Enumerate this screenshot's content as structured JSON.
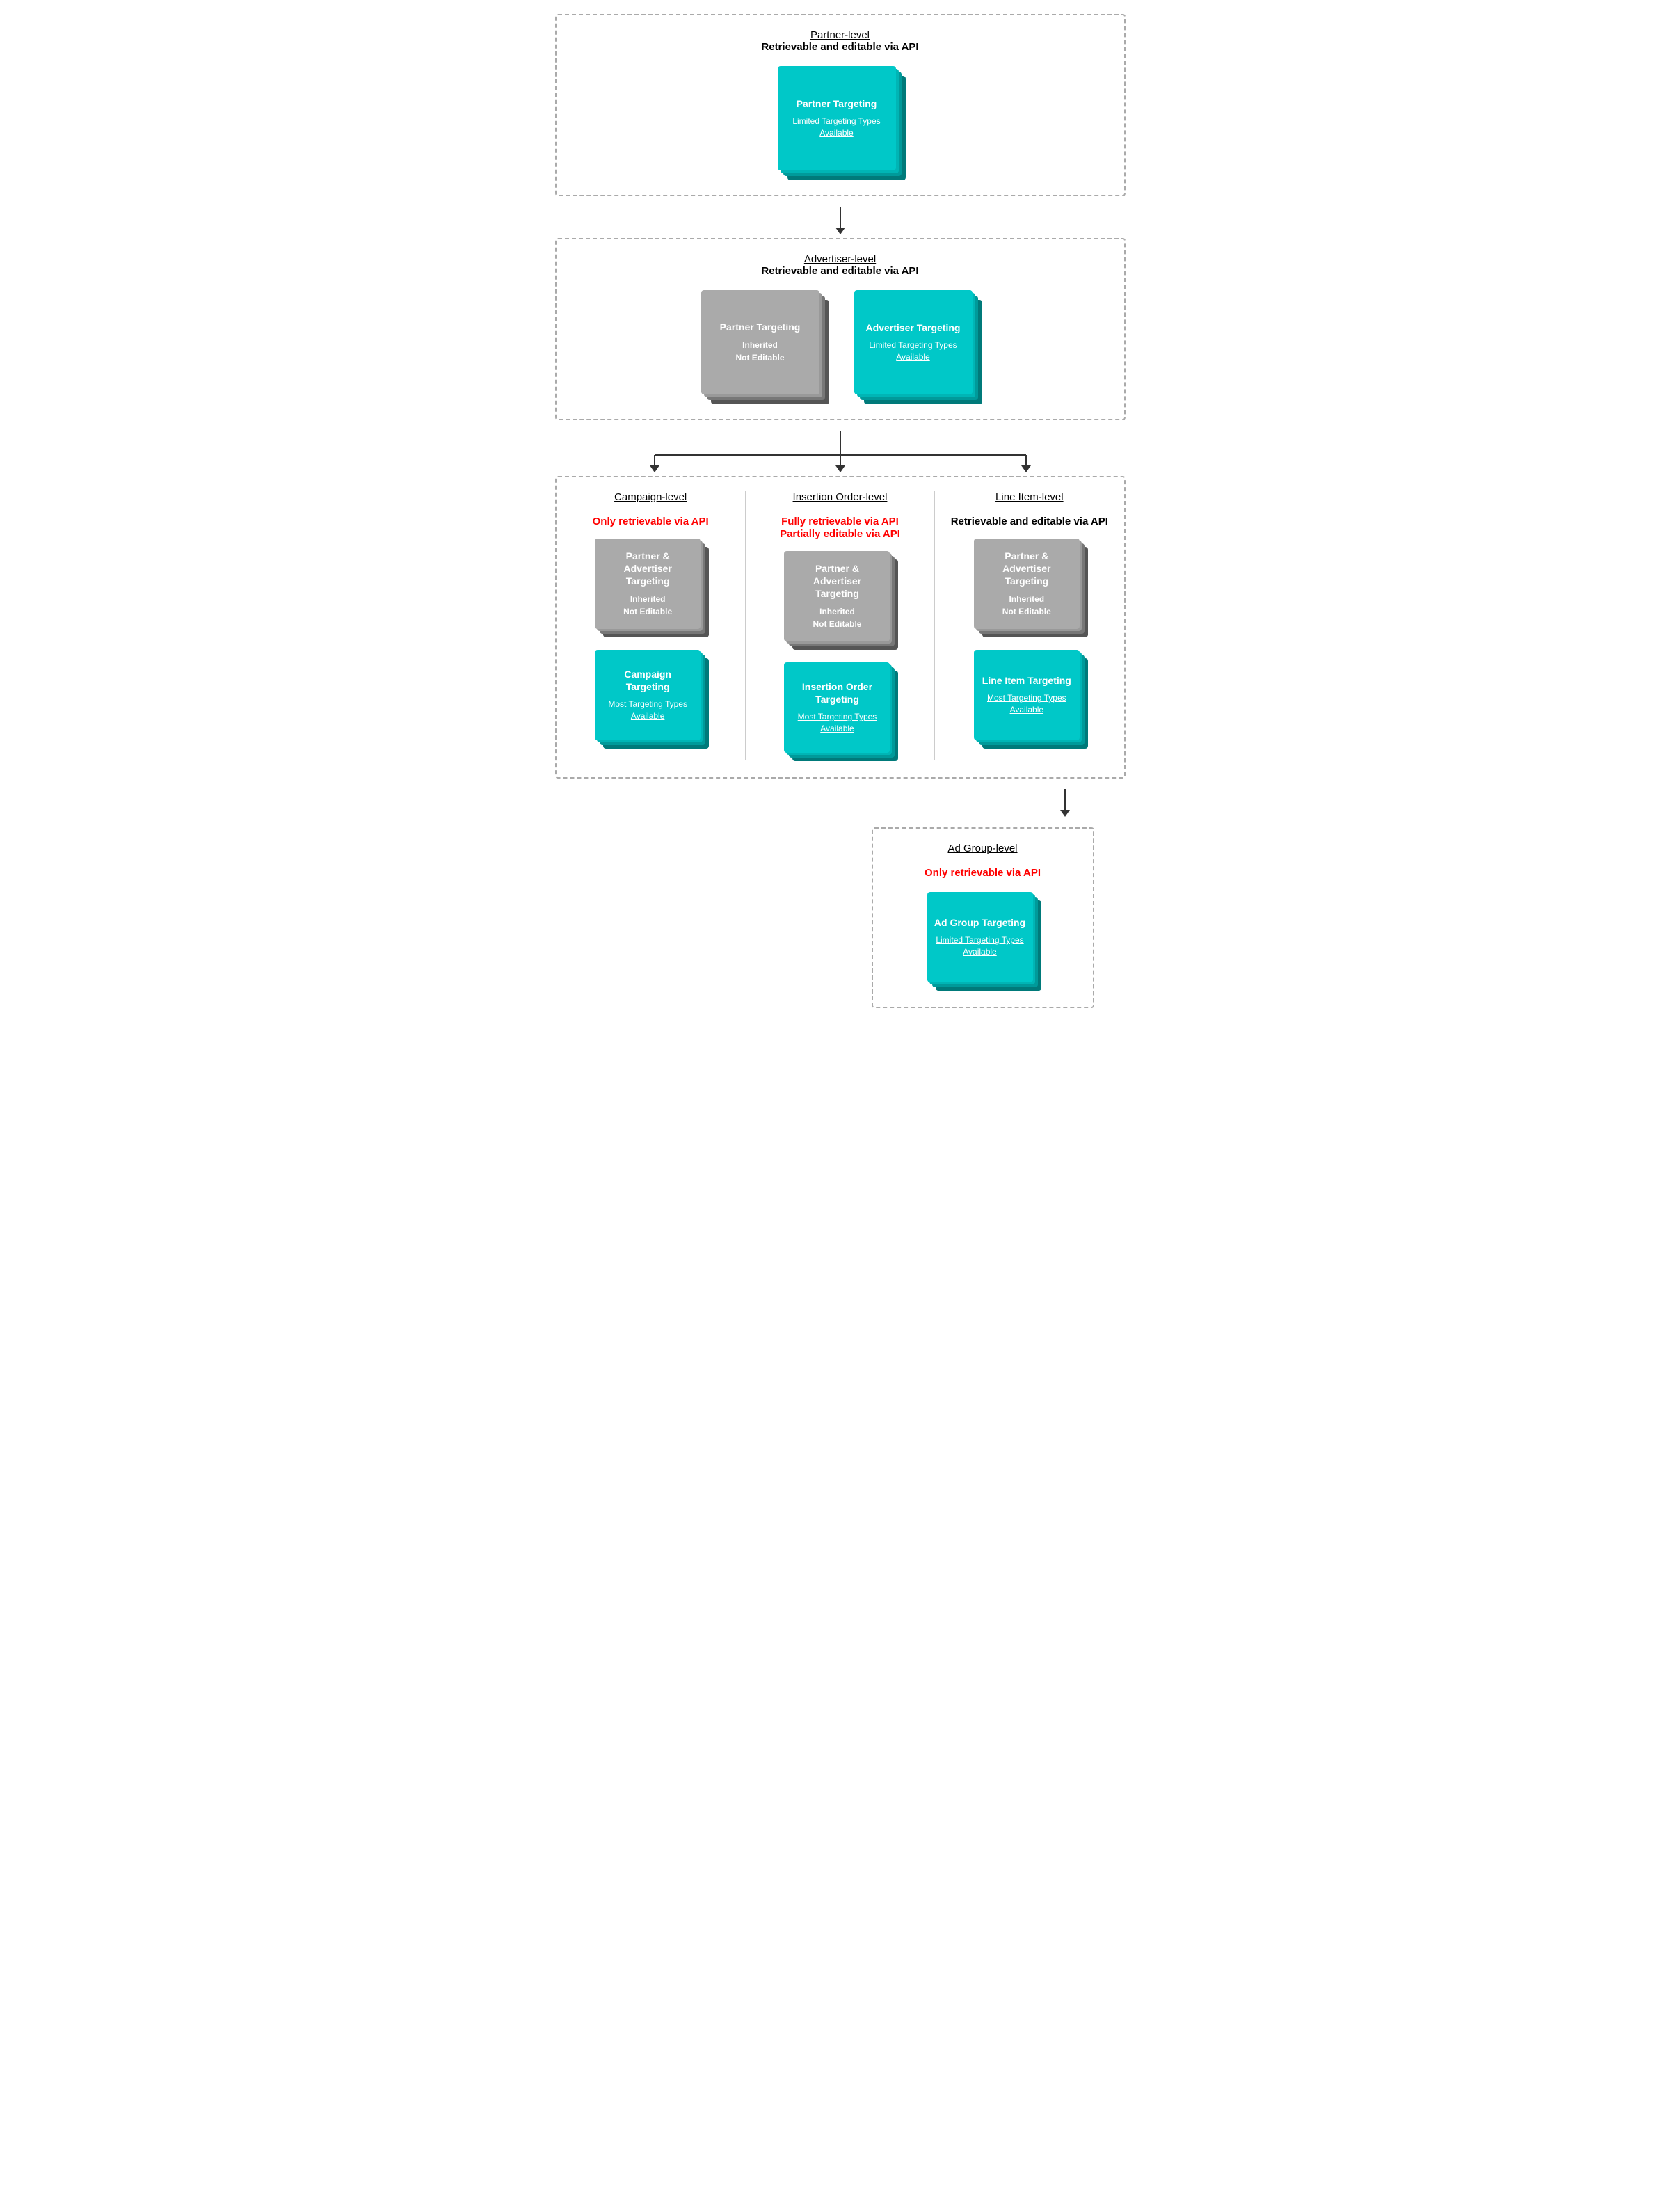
{
  "partner_level": {
    "title": "Partner-level",
    "subtitle": "Retrievable and editable via API",
    "card": {
      "title": "Partner Targeting",
      "link": "Limited Targeting Types Available"
    }
  },
  "advertiser_level": {
    "title": "Advertiser-level",
    "subtitle": "Retrievable and editable via API",
    "card_inherited": {
      "title": "Partner Targeting",
      "line1": "Inherited",
      "line2": "Not Editable"
    },
    "card_advertiser": {
      "title": "Advertiser Targeting",
      "link": "Limited Targeting Types Available"
    }
  },
  "campaign_level": {
    "title": "Campaign-level",
    "subtitle": "Only retrievable via API",
    "card_inherited": {
      "title": "Partner & Advertiser Targeting",
      "line1": "Inherited",
      "line2": "Not Editable"
    },
    "card_campaign": {
      "title": "Campaign Targeting",
      "link": "Most Targeting Types Available"
    }
  },
  "io_level": {
    "title": "Insertion Order-level",
    "subtitle1": "Fully retrievable via API",
    "subtitle2": "Partially editable via API",
    "card_inherited": {
      "title": "Partner & Advertiser Targeting",
      "line1": "Inherited",
      "line2": "Not Editable"
    },
    "card_io": {
      "title": "Insertion Order Targeting",
      "link": "Most Targeting Types Available"
    }
  },
  "li_level": {
    "title": "Line Item-level",
    "subtitle": "Retrievable and editable via API",
    "card_inherited": {
      "title": "Partner & Advertiser Targeting",
      "line1": "Inherited",
      "line2": "Not Editable"
    },
    "card_li": {
      "title": "Line Item Targeting",
      "link": "Most Targeting Types Available"
    }
  },
  "adgroup_level": {
    "title": "Ad Group-level",
    "subtitle": "Only retrievable via API",
    "card_adgroup": {
      "title": "Ad Group Targeting",
      "link": "Limited Targeting Types Available"
    }
  }
}
